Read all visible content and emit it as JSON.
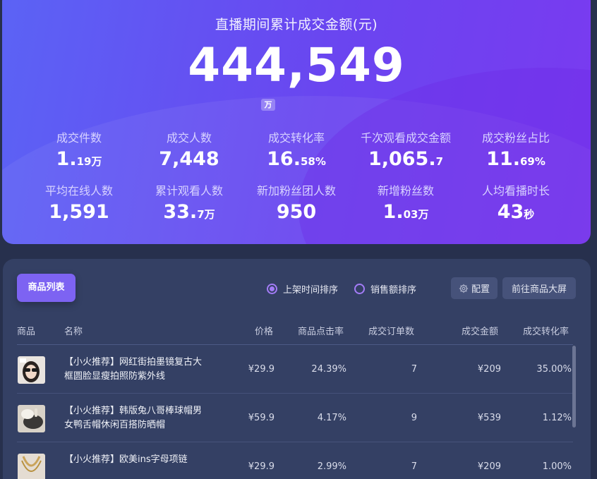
{
  "summary": {
    "title": "直播期间累计成交金额(元)",
    "amount": "444,549",
    "unit": "万",
    "metrics": [
      {
        "label": "成交件数",
        "value_main": "1.",
        "value_small": "19万"
      },
      {
        "label": "成交人数",
        "value_main": "7,448",
        "value_small": ""
      },
      {
        "label": "成交转化率",
        "value_main": "16.",
        "value_small": "58%"
      },
      {
        "label": "千次观看成交金额",
        "value_main": "1,065.",
        "value_small": "7"
      },
      {
        "label": "成交粉丝占比",
        "value_main": "11.",
        "value_small": "69%"
      },
      {
        "label": "平均在线人数",
        "value_main": "1,591",
        "value_small": ""
      },
      {
        "label": "累计观看人数",
        "value_main": "33.",
        "value_small": "7万"
      },
      {
        "label": "新加粉丝团人数",
        "value_main": "950",
        "value_small": ""
      },
      {
        "label": "新增粉丝数",
        "value_main": "1.",
        "value_small": "03万"
      },
      {
        "label": "人均看播时长",
        "value_main": "43",
        "value_small": "秒"
      }
    ]
  },
  "products": {
    "tab_label": "商品列表",
    "sort_options": [
      {
        "label": "上架时间排序",
        "checked": true
      },
      {
        "label": "销售额排序",
        "checked": false
      }
    ],
    "config_label": "配置",
    "big_screen_label": "前往商品大屏",
    "columns": [
      "商品",
      "名称",
      "价格",
      "商品点击率",
      "成交订单数",
      "成交金额",
      "成交转化率"
    ],
    "rows": [
      {
        "name": "【小火推荐】网红街拍墨镜复古大框圆脸显瘦拍照防紫外线",
        "price": "¥29.9",
        "ctr": "24.39%",
        "orders": "7",
        "amount": "¥209",
        "conversion": "35.00%"
      },
      {
        "name": "【小火推荐】韩版兔八哥棒球帽男女鸭舌帽休闲百搭防晒帽",
        "price": "¥59.9",
        "ctr": "4.17%",
        "orders": "9",
        "amount": "¥539",
        "conversion": "1.12%"
      },
      {
        "name": "【小火推荐】欧美ins字母项链",
        "price": "¥29.9",
        "ctr": "2.99%",
        "orders": "7",
        "amount": "¥209",
        "conversion": "1.00%"
      }
    ]
  },
  "colors": {
    "accent": "#7d63f2",
    "card_bg": "#344064",
    "page_bg": "#27304d"
  }
}
